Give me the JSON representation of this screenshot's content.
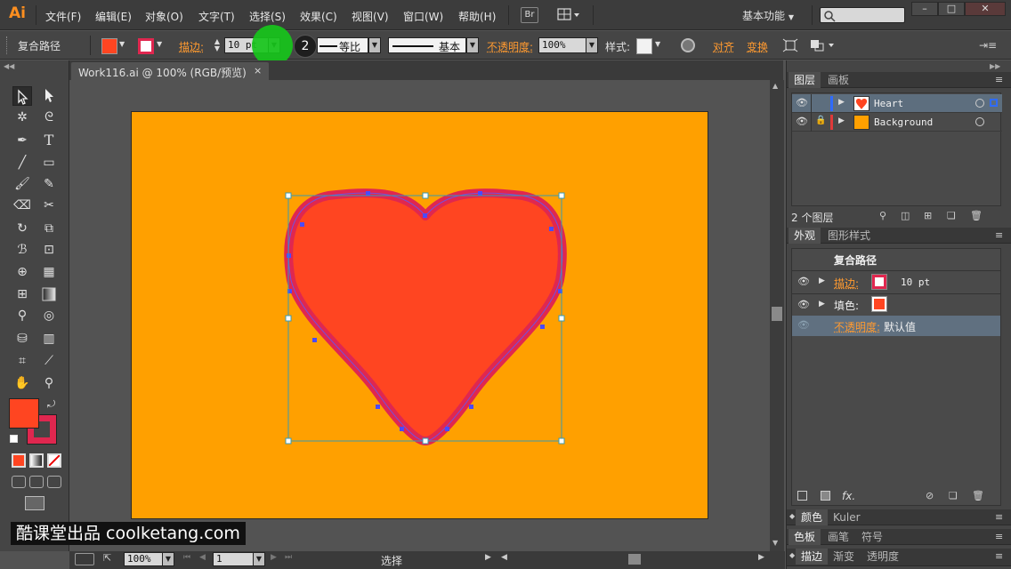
{
  "app": {
    "logo": "Ai",
    "menu": [
      "文件(F)",
      "编辑(E)",
      "对象(O)",
      "文字(T)",
      "选择(S)",
      "效果(C)",
      "视图(V)",
      "窗口(W)",
      "帮助(H)"
    ],
    "bridge_btn": "Br",
    "workspace": "基本功能",
    "window_controls": [
      "–",
      "□",
      "✕"
    ]
  },
  "control_bar": {
    "selection_type": "复合路径",
    "stroke_label": "描边:",
    "stroke_weight": "10 pt",
    "badge_number": "2",
    "profile_label": "等比",
    "brush_label": "基本",
    "opacity_label": "不透明度:",
    "opacity_value": "100%",
    "style_label": "样式:",
    "align_label": "对齐",
    "transform_label": "变换"
  },
  "document": {
    "tab_title": "Work116.ai @ 100% (RGB/预览)",
    "tab_close": "×"
  },
  "canvas": {
    "artboard_color": "#ffa000",
    "heart_fill": "#ff4521",
    "heart_stroke": "#e0274f"
  },
  "status_bar": {
    "zoom": "100%",
    "artboard_num": "1",
    "tool_status": "选择"
  },
  "layers_panel": {
    "tabs": [
      "图层",
      "画板"
    ],
    "layers": [
      {
        "name": "Heart",
        "color": "#2f6bff",
        "thumb_color": "#ff4521",
        "selected": true,
        "locked": false
      },
      {
        "name": "Background",
        "color": "#e03a3a",
        "thumb_color": "#ffa000",
        "selected": false,
        "locked": true
      }
    ],
    "count": "2 个图层"
  },
  "appearance_panel": {
    "tabs": [
      "外观",
      "图形样式"
    ],
    "object_type": "复合路径",
    "stroke_label": "描边:",
    "stroke_value": "10 pt",
    "fill_label": "填色:",
    "opacity_label": "不透明度:",
    "opacity_value": "默认值",
    "fx_label": "fx."
  },
  "collapsed_panels": [
    {
      "tabs": [
        "颜色",
        "Kuler"
      ]
    },
    {
      "tabs": [
        "色板",
        "画笔",
        "符号"
      ]
    },
    {
      "tabs": [
        "描边",
        "渐变",
        "透明度"
      ]
    }
  ],
  "watermark": "酷课堂出品 coolketang.com",
  "colors": {
    "accent_orange": "#ff9a30",
    "fill_swatch": "#ff4521",
    "stroke_swatch": "#e0274f"
  }
}
